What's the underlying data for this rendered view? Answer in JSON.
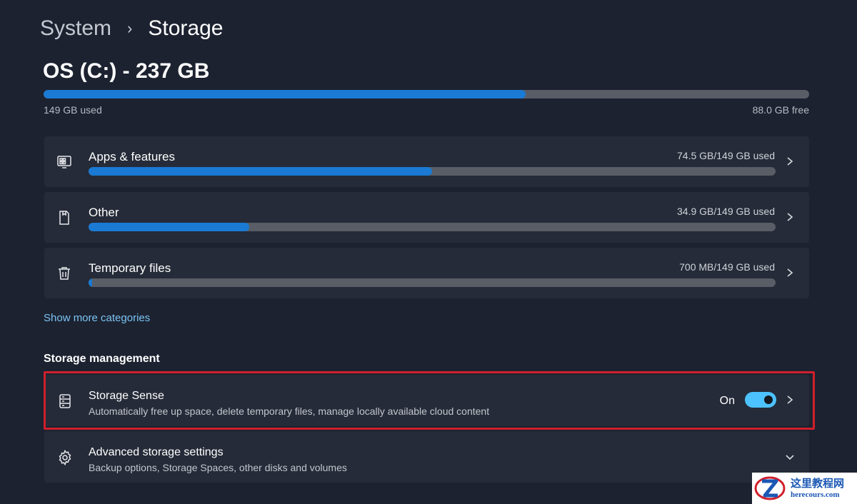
{
  "breadcrumb": {
    "parent": "System",
    "separator": "›",
    "current": "Storage"
  },
  "drive": {
    "title": "OS (C:) - 237 GB",
    "used_label": "149 GB used",
    "free_label": "88.0 GB free",
    "used_fraction": 0.63
  },
  "categories": [
    {
      "label": "Apps & features",
      "amount": "74.5 GB/149 GB used",
      "fraction": 0.5,
      "icon": "apps-icon"
    },
    {
      "label": "Other",
      "amount": "34.9 GB/149 GB used",
      "fraction": 0.234,
      "icon": "other-files-icon"
    },
    {
      "label": "Temporary files",
      "amount": "700 MB/149 GB used",
      "fraction": 0.005,
      "icon": "trash-icon"
    }
  ],
  "show_more": "Show more categories",
  "management": {
    "title": "Storage management",
    "storage_sense": {
      "label": "Storage Sense",
      "description": "Automatically free up space, delete temporary files, manage locally available cloud content",
      "toggle_state": "On",
      "icon": "storage-drive-icon"
    },
    "advanced": {
      "label": "Advanced storage settings",
      "description": "Backup options, Storage Spaces, other disks and volumes",
      "icon": "gear-icon"
    }
  },
  "watermark": {
    "chinese": "这里教程网",
    "domain": "herecours.com"
  },
  "colors": {
    "accent": "#1a7ad4",
    "toggle_on": "#4cc2ff",
    "link": "#7cc4f4",
    "highlight": "#d01f2b",
    "background": "#1c2230",
    "card": "#252b38"
  }
}
